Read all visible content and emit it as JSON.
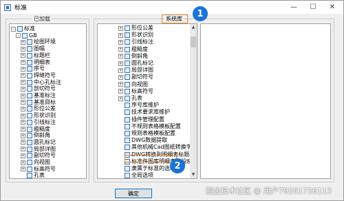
{
  "window": {
    "title": "标准"
  },
  "groups": {
    "loaded_legend": "已加载",
    "system_legend": "系统库"
  },
  "left_tree": [
    {
      "label": "标准",
      "level": 0,
      "exp": "-"
    },
    {
      "label": "GB",
      "level": 1,
      "exp": "-"
    },
    {
      "label": "绘图环境",
      "level": 2,
      "exp": "+"
    },
    {
      "label": "图幅",
      "level": 2,
      "exp": "+"
    },
    {
      "label": "标题栏",
      "level": 2,
      "exp": "+"
    },
    {
      "label": "明细表",
      "level": 2,
      "exp": "+"
    },
    {
      "label": "序号",
      "level": 2,
      "exp": "+"
    },
    {
      "label": "焊缝符号",
      "level": 2,
      "exp": "+"
    },
    {
      "label": "中心孔标注",
      "level": 2,
      "exp": "+"
    },
    {
      "label": "剖切符号",
      "level": 2,
      "exp": "+"
    },
    {
      "label": "基准标注",
      "level": 2,
      "exp": "+"
    },
    {
      "label": "基准目标",
      "level": 2,
      "exp": "+"
    },
    {
      "label": "形位公差",
      "level": 2,
      "exp": "+"
    },
    {
      "label": "形状识别",
      "level": 2,
      "exp": "+"
    },
    {
      "label": "引线标注",
      "level": 2,
      "exp": "+"
    },
    {
      "label": "粗糙度",
      "level": 2,
      "exp": "+"
    },
    {
      "label": "倒斜角",
      "level": 2,
      "exp": "+"
    },
    {
      "label": "圆孔标记",
      "level": 2,
      "exp": "+"
    },
    {
      "label": "局部详图",
      "level": 2,
      "exp": "+"
    },
    {
      "label": "副切符号",
      "level": 2,
      "exp": "+"
    },
    {
      "label": "向视图",
      "level": 2,
      "exp": "+"
    },
    {
      "label": "标高符号",
      "level": 2,
      "exp": "+"
    },
    {
      "label": "孔表",
      "level": 2,
      "exp": ""
    }
  ],
  "right_tree": [
    {
      "label": "形位公差",
      "exp": "+"
    },
    {
      "label": "形状识别",
      "exp": "+"
    },
    {
      "label": "引线标注",
      "exp": "+"
    },
    {
      "label": "粗糙度",
      "exp": "+"
    },
    {
      "label": "倒斜角",
      "exp": "+"
    },
    {
      "label": "圆孔标记",
      "exp": "+"
    },
    {
      "label": "局部详图",
      "exp": "+"
    },
    {
      "label": "副切符号",
      "exp": "+"
    },
    {
      "label": "向视图",
      "exp": "+"
    },
    {
      "label": "标高符号",
      "exp": "+"
    },
    {
      "label": "孔表",
      "exp": "+"
    },
    {
      "label": "序号库维护",
      "exp": ""
    },
    {
      "label": "技术要求库维护",
      "exp": ""
    },
    {
      "label": "插件管理配置",
      "exp": ""
    },
    {
      "label": "不规则表格模板配置",
      "exp": ""
    },
    {
      "label": "规则表格模板配置",
      "exp": ""
    },
    {
      "label": "DWG数据提取",
      "exp": ""
    },
    {
      "label": "其他机械Cad图纸转换字段",
      "exp": ""
    },
    {
      "label": "DWG转换到明细表标题栏字",
      "exp": ""
    },
    {
      "label": "标准件图库明细表字段映射",
      "exp": ""
    },
    {
      "label": "隶属于标准的选项",
      "exp": ""
    },
    {
      "label": "全局选项",
      "exp": ""
    }
  ],
  "callouts": [
    "1",
    "2"
  ],
  "buttons": {
    "ok": "确定"
  },
  "watermark": "掘金技术社区 @ 用户7926172611​3",
  "colors": {
    "annotation_orange": "#e8822b",
    "callout_blue": "#1a73d8"
  }
}
